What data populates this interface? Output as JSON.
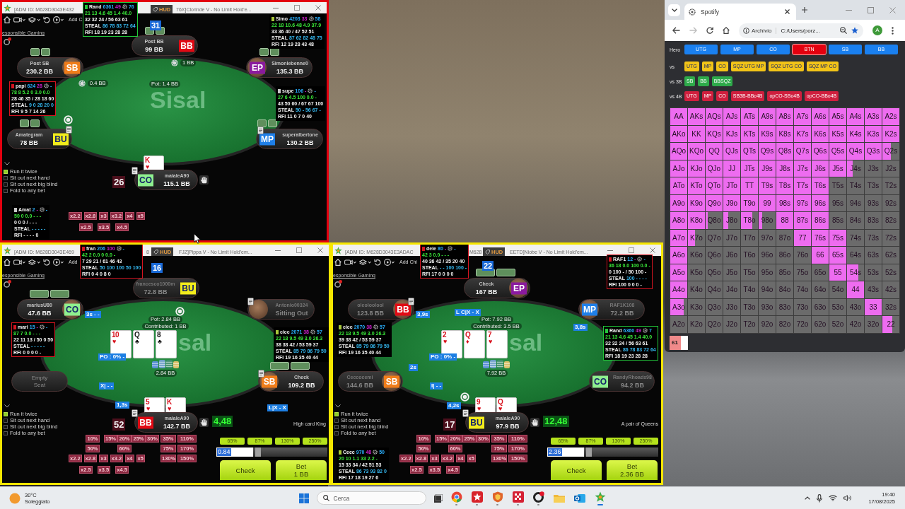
{
  "tables": [
    {
      "color": "#e3000f",
      "title": [
        "[ADM ID: M628D3043E432",
        "76X]Clorinde V - No Limit Hold'e..."
      ],
      "hud_tag": "HUD",
      "toolbar_link": "Add C",
      "responsible_gaming": "esponsible Gaming",
      "dealer_number": "31",
      "logo": "Sisal",
      "seats": [
        {
          "kind": "player",
          "label": "Post BB",
          "stack": "99 BB",
          "badge": {
            "text": "BB",
            "color": "#e10a14"
          },
          "active": true,
          "avatar": false,
          "has_cards": true
        },
        {
          "kind": "player",
          "label": "Post SB",
          "stack": "230.2 BB",
          "badge": {
            "text": "SB",
            "color": "#f07d1a"
          },
          "active": true,
          "avatar": true,
          "has_cards": true
        },
        {
          "kind": "player",
          "label": "Simonlebenne0",
          "stack": "135.3 BB",
          "badge": {
            "text": "EP",
            "color": "#8a1a9e"
          },
          "active": true,
          "avatar": true,
          "has_cards": true
        },
        {
          "kind": "player",
          "label": "Amategram",
          "stack": "78 BB",
          "badge": {
            "text": "BU",
            "color": "#f2ec1c"
          },
          "active": true,
          "avatar": false,
          "has_cards": true
        },
        {
          "kind": "player",
          "label": "superalbertone",
          "stack": "130.2 BB",
          "badge": {
            "text": "MP",
            "color": "#1f7fe8"
          },
          "active": true,
          "avatar": false,
          "has_cards": true
        },
        {
          "kind": "player",
          "label": "maialeA90",
          "stack": "115.1 BB",
          "badge": {
            "text": "CO",
            "color": "#8ff08f"
          },
          "active": true,
          "avatar": false,
          "has_cards": false
        }
      ],
      "huds": [
        {
          "name": "Rand",
          "count": "6361",
          "stat_1": "49",
          "stat_2": "76",
          "line_1": "21 13 4.6 45 1.4 40.0",
          "line_2": "32 32 24 / 56 63 61",
          "steal_label": "STEAL",
          "steal": "86 78 83 72 64",
          "rfi_label": "RFI",
          "rfi": "18 19 23 28 28",
          "color": "#22c83a",
          "outlined": true
        },
        {
          "name": "Simo",
          "count": "4203",
          "stat_1": "33",
          "stat_2": "58",
          "line_1": "22 18 10.6 48 4.9 37.9",
          "line_2": "33 36 40 / 47 52 51",
          "steal_label": "STEAL",
          "steal": "87 62 82 48 75",
          "rfi_label": "RFI",
          "rfi": "12 19 28 43 48",
          "color": "#a8c83a",
          "outlined": false
        },
        {
          "name": "papi",
          "count": "624",
          "stat_1": "28",
          "stat_2": "-",
          "line_1": "78 8 5.2 0 3.0 0.0",
          "line_2": "28 46 35 / 28 18 60",
          "steal_label": "STEAL",
          "steal": "9 0 28 20 0",
          "rfi_label": "RFI",
          "rfi": "9 5 7 14 26",
          "color": "#d41420",
          "outlined": true
        },
        {
          "name": "supe",
          "count": "106",
          "stat_1": "-",
          "stat_2": "-",
          "line_1": "27 6 4.5 100 0.0 -",
          "line_2": "43 50 60 / 67 67 100",
          "steal_label": "STEAL",
          "steal": "50 - 56 67 -",
          "rfi_label": "RFI",
          "rfi": "11 0 7 0 40",
          "color": "#c8c8c8",
          "outlined": false
        },
        {
          "name": "Amat",
          "count": "2",
          "stat_1": "-",
          "stat_2": "-",
          "line_1": "50 0 0.0 - - -",
          "line_2": "0 0 0 / - - -",
          "steal_label": "STEAL",
          "steal": "- - - - -",
          "rfi_label": "RFI",
          "rfi": "- - - - 0",
          "color": "#c8c8c8",
          "outlined": false
        }
      ],
      "pot": "Pot: 1.4 BB",
      "bets": [
        "0.4 BB",
        "1 BB"
      ],
      "hero_cards": [
        {
          "rank": "K",
          "suit": "♥",
          "color": "#d8101c"
        }
      ],
      "counter": "26",
      "options": [
        {
          "label": "Run it twice",
          "checked": true
        },
        {
          "label": "Sit out next hand",
          "checked": false
        },
        {
          "label": "Sit out next big blind",
          "checked": false
        },
        {
          "label": "Fold to any bet",
          "checked": false
        }
      ],
      "multipliers": [
        [
          "x2.2",
          "x2.8",
          "x3",
          "x3.2",
          "x4",
          "x5"
        ],
        [
          "x2.5",
          "x3.5",
          "x4.5"
        ]
      ]
    },
    {
      "color": "#f5e600",
      "title": [
        "[ADM ID: M628D3043E469",
        "8",
        "FJZ]Pippa V - No Limit Hold'em..."
      ],
      "hud_tag": "HUD",
      "toolbar_link": "Add",
      "responsible_gaming": "esponsible Gaming",
      "dealer_number": "16",
      "logo": "sal",
      "seats": [
        {
          "kind": "player",
          "label": "francesco1000m",
          "stack": "72.8 BB",
          "badge": {
            "text": "BU",
            "color": "#f2ec1c"
          },
          "active": false,
          "avatar": false,
          "has_cards": false
        },
        {
          "kind": "player",
          "label": "mariusU80",
          "stack": "47.6 BB",
          "badge": {
            "text": "CO",
            "color": "#8ff08f"
          },
          "active": true,
          "avatar": true,
          "has_cards": true
        },
        {
          "kind": "player",
          "label": "Antonio00324",
          "stack": "Sitting Out",
          "active": false,
          "avatar": true,
          "has_cards": false
        },
        {
          "kind": "empty",
          "label": "Empty Seat"
        },
        {
          "kind": "player",
          "label": "Check",
          "stack": "109.2 BB",
          "badge": {
            "text": "SB",
            "color": "#f07d1a"
          },
          "active": true,
          "avatar": true,
          "has_cards": true
        },
        {
          "kind": "player",
          "label": "maialeA90",
          "stack": "142.7 BB",
          "badge": {
            "text": "BB",
            "color": "#e10a14"
          },
          "active": true,
          "avatar": false,
          "has_cards": false
        }
      ],
      "huds": [
        {
          "name": "fran",
          "count": "206",
          "stat_1": "100",
          "stat_2": "-",
          "line_1": "42 2 0.0 0 0.0 -",
          "line_2": "7 29 21 / 61 46 43",
          "steal_label": "STEAL",
          "steal": "50 100 100 50 100",
          "rfi_label": "RFI",
          "rfi": "0 4 0 8 0",
          "color": "#d41420",
          "outlined": true
        },
        {
          "name": "mari",
          "count": "15",
          "stat_1": "-",
          "stat_2": "-",
          "line_1": "87 7 0.0 - - -",
          "line_2": "22 11 13 / 50 0 50",
          "steal_label": "STEAL",
          "steal": "- - - - -",
          "rfi_label": "RFI",
          "rfi": "0 0 0 0 -",
          "color": "#d41420",
          "outlined": true
        },
        {
          "name": "cicc",
          "count": "2071",
          "stat_1": "38",
          "stat_2": "57",
          "line_1": "22 18 9.5 49 3.0 26.3",
          "line_2": "38 38 42 / 53 59 37",
          "steal_label": "STEAL",
          "steal": "85 79 86 79 50",
          "rfi_label": "RFI",
          "rfi": "19 16 35 40 44",
          "color": "#a8c83a",
          "outlined": false
        }
      ],
      "board": [
        {
          "rank": "10",
          "suit": "♥",
          "color": "#d8101c"
        },
        {
          "rank": "Q",
          "suit": "♣",
          "color": "#111111"
        },
        {
          "rank": "8",
          "suit": "♣",
          "color": "#111111"
        }
      ],
      "pot": "Pot: 2.84 BB",
      "contributed": "Contributed: 1 BB",
      "bets": [
        "2.84 BB"
      ],
      "tags": [
        "3s - -",
        "PO : 0% -",
        "X| - -",
        "1,3s",
        "L|X - X"
      ],
      "hero_cards": [
        {
          "rank": "5",
          "suit": "♥",
          "color": "#d8101c"
        },
        {
          "rank": "K",
          "suit": "♥",
          "color": "#d8101c"
        }
      ],
      "counter": "52",
      "equity": "4,48",
      "hand_rank": "High card King",
      "options": [
        {
          "label": "Run it twice",
          "checked": true
        },
        {
          "label": "Sit out next hand",
          "checked": false
        },
        {
          "label": "Sit out next big blind",
          "checked": false
        },
        {
          "label": "Fold to any bet",
          "checked": false
        }
      ],
      "percents": [
        [
          "10%",
          "15%",
          "20%",
          "25%",
          "30%",
          "35%",
          "110%"
        ],
        [
          "50%",
          "60%",
          "75%",
          "170%"
        ],
        [
          "130%",
          "150%"
        ]
      ],
      "multipliers": [
        [
          "x2.2",
          "x2.8",
          "x3",
          "x3.2",
          "x4",
          "x5"
        ],
        [
          "x2.5",
          "x3.5",
          "x4.5"
        ]
      ],
      "action": {
        "presets": [
          "65%",
          "87%",
          "130%",
          "250%"
        ],
        "amount": "0.84",
        "slider": {
          "level": 0.03
        },
        "buttons": [
          {
            "label": "Check"
          },
          {
            "label": "Bet",
            "amount": "1 BB"
          }
        ]
      }
    },
    {
      "color": "#f5e600",
      "title": [
        "[ADM ID: M628D3043E3ADAC",
        "M628",
        "EETD]Niobe V - No Limit Hold'em..."
      ],
      "hud_tag": "HUD",
      "toolbar_link": "Add Chi",
      "responsible_gaming": "esponsible Gaming",
      "dealer_number": "22",
      "logo": "sal",
      "seats": [
        {
          "kind": "player",
          "label": "Check",
          "stack": "167 BB",
          "badge": {
            "text": "EP",
            "color": "#8a1a9e"
          },
          "active": true,
          "avatar": true,
          "has_cards": true
        },
        {
          "kind": "player",
          "label": "oleoloolool",
          "stack": "123.8 BB",
          "badge": {
            "text": "BB",
            "color": "#e10a14"
          },
          "active": false,
          "avatar": true,
          "has_cards": false
        },
        {
          "kind": "player",
          "label": "RAF1K108",
          "stack": "72.2 BB",
          "badge": {
            "text": "MP",
            "color": "#1f7fe8"
          },
          "active": false,
          "avatar": true,
          "has_cards": false
        },
        {
          "kind": "player",
          "label": "Ceccocemi",
          "stack": "144.6 BB",
          "badge": {
            "text": "SB",
            "color": "#f07d1a"
          },
          "active": false,
          "avatar": true,
          "has_cards": false
        },
        {
          "kind": "player",
          "label": "RandyRhoads98",
          "stack": "94.2 BB",
          "badge": {
            "text": "CO",
            "color": "#8ff08f"
          },
          "active": false,
          "avatar": false,
          "has_cards": false
        },
        {
          "kind": "player",
          "label": "maialeA90",
          "stack": "97.9 BB",
          "badge": {
            "text": "BU",
            "color": "#f2ec1c"
          },
          "active": true,
          "avatar": false,
          "has_cards": false
        }
      ],
      "huds": [
        {
          "name": "dele",
          "count": "80",
          "stat_1": "-",
          "stat_2": "-",
          "line_1": "42 3 0.0 - - -",
          "line_2": "40 36 42 / 35 20 40",
          "steal_label": "STEAL",
          "steal": "- - 100 100 -",
          "rfi_label": "RFI",
          "rfi": "17 0 0 0 0",
          "color": "#d41420",
          "outlined": true
        },
        {
          "name": "RAF1",
          "count": "12",
          "stat_1": "-",
          "stat_2": "-",
          "line_1": "36 18 0.0 100 0.0 -",
          "line_2": "0 100 - / 50 100 -",
          "steal_label": "STEAL",
          "steal": "100 - - - -",
          "rfi_label": "RFI",
          "rfi": "100 0 0 0 -",
          "color": "#d41420",
          "outlined": true
        },
        {
          "name": "cicc",
          "count": "2070",
          "stat_1": "38",
          "stat_2": "57",
          "line_1": "22 18 9.5 49 3.0 26.3",
          "line_2": "39 38 42 / 53 59 37",
          "steal_label": "STEAL",
          "steal": "85 79 86 79 50",
          "rfi_label": "RFI",
          "rfi": "19 16 35 40 44",
          "color": "#a8c83a",
          "outlined": false
        },
        {
          "name": "Rand",
          "count": "6360",
          "stat_1": "49",
          "stat_2": "7",
          "line_1": "21 13 4.6 45 1.4 40.0",
          "line_2": "32 32 24 / 56 63 61",
          "steal_label": "STEAL",
          "steal": "86 78 83 72 64",
          "rfi_label": "RFI",
          "rfi": "18 19 23 28 28",
          "color": "#22c83a",
          "outlined": true
        },
        {
          "name": "Cecc",
          "count": "970",
          "stat_1": "48",
          "stat_2": "50",
          "line_1": "20 10 1.1 33 2.2 -",
          "line_2": "15 33 34 / 42 51 53",
          "steal_label": "STEAL",
          "steal": "86 73 93 82 0",
          "rfi_label": "RFI",
          "rfi": "17 18 19 27 6",
          "color": "#a8c83a",
          "outlined": false
        }
      ],
      "board": [
        {
          "rank": "2",
          "suit": "♥",
          "color": "#d8101c"
        },
        {
          "rank": "Q",
          "suit": "♦",
          "color": "#d8101c"
        },
        {
          "rank": "7",
          "suit": "♥",
          "color": "#d8101c"
        }
      ],
      "pot": "Pot: 7.92 BB",
      "contributed": "Contributed: 3.5 BB",
      "bets": [
        "7.92 BB"
      ],
      "tags": [
        "3,9s",
        "L C|X - X",
        "3,8s",
        "PO : 0% -",
        "2s",
        "I| - -",
        "4,2s"
      ],
      "hero_cards": [
        {
          "rank": "9",
          "suit": "♥",
          "color": "#d8101c"
        },
        {
          "rank": "Q",
          "suit": "♥",
          "color": "#d8101c"
        }
      ],
      "counter": "17",
      "equity": "12,48",
      "hand_rank": "A pair of Queens",
      "options": [
        {
          "label": "Run it twice",
          "checked": true
        },
        {
          "label": "Sit out next hand",
          "checked": false
        },
        {
          "label": "Sit out next big blind",
          "checked": false
        },
        {
          "label": "Fold to any bet",
          "checked": false
        }
      ],
      "percents": [
        [
          "10%",
          "15%",
          "20%",
          "25%",
          "30%",
          "35%",
          "110%"
        ],
        [
          "50%",
          "60%",
          "75%",
          "170%"
        ],
        [
          "130%",
          "150%"
        ]
      ],
      "multipliers": [
        [
          "x2.2",
          "x2.8",
          "x3",
          "x3.2",
          "x4",
          "x5"
        ],
        [
          "x2.5",
          "x3.5",
          "x4.5"
        ]
      ],
      "action": {
        "presets": [
          "65%",
          "87%",
          "130%",
          "250%"
        ],
        "amount": "2.36",
        "slider": {
          "level": 0.03
        },
        "buttons": [
          {
            "label": "Check"
          },
          {
            "label": "Bet",
            "amount": "2.36 BB"
          }
        ]
      }
    }
  ],
  "browser": {
    "tab": "Spotify",
    "forward_disabled": true,
    "address_label": "Archivio",
    "address": "C:/Users/porz...",
    "profile": "A",
    "range_groups": [
      {
        "label": "Hero",
        "color": "#1a80f0",
        "buttons": [
          {
            "label": "UTG",
            "selected": false
          },
          {
            "label": "MP",
            "selected": false
          },
          {
            "label": "CO",
            "selected": false
          },
          {
            "label": "BTN",
            "selected": true
          },
          {
            "label": "SB",
            "selected": false
          },
          {
            "label": "BB",
            "selected": false
          }
        ]
      },
      {
        "label": "vs",
        "color": "#f2c418",
        "buttons": [
          {
            "label": "UTG",
            "selected": false
          },
          {
            "label": "MP",
            "selected": false
          },
          {
            "label": "CO",
            "selected": false
          },
          {
            "label": "SQZ UTG MP",
            "selected": false
          },
          {
            "label": "SQZ UTG CO",
            "selected": false
          },
          {
            "label": "SQZ MP CO",
            "selected": false
          }
        ]
      },
      {
        "label": "vs 3B",
        "color": "#2eaa4a",
        "buttons": [
          {
            "label": "SB",
            "selected": false
          },
          {
            "label": "BB",
            "selected": false
          },
          {
            "label": "BBSQZ",
            "selected": false
          }
        ]
      },
      {
        "label": "vs 4B",
        "color": "#cf1f3e",
        "buttons": [
          {
            "label": "UTG",
            "selected": false
          },
          {
            "label": "MP",
            "selected": false
          },
          {
            "label": "CO",
            "selected": false
          },
          {
            "label": "SB3B-BBc4B",
            "selected": false
          },
          {
            "label": "opCO-SBo4B",
            "selected": false
          },
          {
            "label": "opCO-BBo4B",
            "selected": false
          }
        ]
      }
    ],
    "range": [
      [
        {
          "hand": "AA",
          "in_range": true
        },
        {
          "hand": "AKs",
          "in_range": true
        },
        {
          "hand": "AQs",
          "in_range": true
        },
        {
          "hand": "AJs",
          "in_range": true
        },
        {
          "hand": "ATs",
          "in_range": true
        },
        {
          "hand": "A9s",
          "in_range": true
        },
        {
          "hand": "A8s",
          "in_range": true
        },
        {
          "hand": "A7s",
          "in_range": true
        },
        {
          "hand": "A6s",
          "in_range": true
        },
        {
          "hand": "A5s",
          "in_range": true
        },
        {
          "hand": "A4s",
          "in_range": true
        },
        {
          "hand": "A3s",
          "in_range": true
        },
        {
          "hand": "A2s",
          "in_range": true
        }
      ],
      [
        {
          "hand": "AKo",
          "in_range": true
        },
        {
          "hand": "KK",
          "in_range": true
        },
        {
          "hand": "KQs",
          "in_range": true
        },
        {
          "hand": "KJs",
          "in_range": true
        },
        {
          "hand": "KTs",
          "in_range": true
        },
        {
          "hand": "K9s",
          "in_range": true
        },
        {
          "hand": "K8s",
          "in_range": true
        },
        {
          "hand": "K7s",
          "in_range": true
        },
        {
          "hand": "K6s",
          "in_range": true
        },
        {
          "hand": "K5s",
          "in_range": true
        },
        {
          "hand": "K4s",
          "in_range": true
        },
        {
          "hand": "K3s",
          "in_range": true
        },
        {
          "hand": "K2s",
          "in_range": true
        }
      ],
      [
        {
          "hand": "AQo",
          "in_range": true
        },
        {
          "hand": "KQo",
          "in_range": true
        },
        {
          "hand": "QQ",
          "in_range": true
        },
        {
          "hand": "QJs",
          "in_range": true
        },
        {
          "hand": "QTs",
          "in_range": true
        },
        {
          "hand": "Q9s",
          "in_range": true
        },
        {
          "hand": "Q8s",
          "in_range": true
        },
        {
          "hand": "Q7s",
          "in_range": true
        },
        {
          "hand": "Q6s",
          "in_range": true
        },
        {
          "hand": "Q5s",
          "in_range": true
        },
        {
          "hand": "Q4s",
          "in_range": true
        },
        {
          "hand": "Q3s",
          "in_range": true
        },
        {
          "hand": "Q2s",
          "level": 0.5
        }
      ],
      [
        {
          "hand": "AJo",
          "in_range": true
        },
        {
          "hand": "KJo",
          "in_range": true
        },
        {
          "hand": "QJo",
          "in_range": true
        },
        {
          "hand": "JJ",
          "in_range": true
        },
        {
          "hand": "JTs",
          "in_range": true
        },
        {
          "hand": "J9s",
          "in_range": true
        },
        {
          "hand": "J8s",
          "in_range": true
        },
        {
          "hand": "J7s",
          "in_range": true
        },
        {
          "hand": "J6s",
          "in_range": true
        },
        {
          "hand": "J5s",
          "in_range": true
        },
        {
          "hand": "J4s",
          "level": 0.35
        },
        {
          "hand": "J3s",
          "in_range": false
        },
        {
          "hand": "J2s",
          "in_range": false
        }
      ],
      [
        {
          "hand": "ATo",
          "in_range": true
        },
        {
          "hand": "KTo",
          "in_range": true
        },
        {
          "hand": "QTo",
          "in_range": true
        },
        {
          "hand": "JTo",
          "in_range": true
        },
        {
          "hand": "TT",
          "in_range": true
        },
        {
          "hand": "T9s",
          "in_range": true
        },
        {
          "hand": "T8s",
          "in_range": true
        },
        {
          "hand": "T7s",
          "in_range": true
        },
        {
          "hand": "T6s",
          "in_range": true
        },
        {
          "hand": "T5s",
          "in_range": false
        },
        {
          "hand": "T4s",
          "in_range": false
        },
        {
          "hand": "T3s",
          "in_range": false
        },
        {
          "hand": "T2s",
          "in_range": false
        }
      ],
      [
        {
          "hand": "A9o",
          "in_range": true
        },
        {
          "hand": "K9o",
          "in_range": true
        },
        {
          "hand": "Q9o",
          "in_range": true
        },
        {
          "hand": "J9o",
          "in_range": true
        },
        {
          "hand": "T9o",
          "in_range": true
        },
        {
          "hand": "99",
          "in_range": true
        },
        {
          "hand": "98s",
          "in_range": true
        },
        {
          "hand": "97s",
          "in_range": true
        },
        {
          "hand": "96s",
          "in_range": true
        },
        {
          "hand": "95s",
          "in_range": false
        },
        {
          "hand": "94s",
          "in_range": false
        },
        {
          "hand": "93s",
          "in_range": false
        },
        {
          "hand": "92s",
          "in_range": false
        }
      ],
      [
        {
          "hand": "A8o",
          "in_range": true
        },
        {
          "hand": "K8o",
          "in_range": true
        },
        {
          "hand": "Q8o",
          "level": 0.13
        },
        {
          "hand": "J8o",
          "level": 0.3
        },
        {
          "hand": "T8o",
          "level": 0.65
        },
        {
          "hand": "98o",
          "level": 0.2
        },
        {
          "hand": "88",
          "in_range": true
        },
        {
          "hand": "87s",
          "in_range": true
        },
        {
          "hand": "86s",
          "in_range": true
        },
        {
          "hand": "85s",
          "in_range": false
        },
        {
          "hand": "84s",
          "in_range": false
        },
        {
          "hand": "83s",
          "in_range": false
        },
        {
          "hand": "82s",
          "in_range": false
        }
      ],
      [
        {
          "hand": "A7o",
          "in_range": true
        },
        {
          "hand": "K7o",
          "level": 0.4
        },
        {
          "hand": "Q7o",
          "in_range": false
        },
        {
          "hand": "J7o",
          "in_range": false
        },
        {
          "hand": "T7o",
          "in_range": false
        },
        {
          "hand": "97o",
          "in_range": false
        },
        {
          "hand": "87o",
          "in_range": false
        },
        {
          "hand": "77",
          "in_range": true
        },
        {
          "hand": "76s",
          "in_range": true
        },
        {
          "hand": "75s",
          "in_range": true
        },
        {
          "hand": "74s",
          "in_range": false
        },
        {
          "hand": "73s",
          "in_range": false
        },
        {
          "hand": "72s",
          "in_range": false
        }
      ],
      [
        {
          "hand": "A6o",
          "in_range": true
        },
        {
          "hand": "K6o",
          "in_range": false
        },
        {
          "hand": "Q6o",
          "in_range": false
        },
        {
          "hand": "J6o",
          "in_range": false
        },
        {
          "hand": "T6o",
          "in_range": false
        },
        {
          "hand": "96o",
          "in_range": false
        },
        {
          "hand": "86o",
          "in_range": false
        },
        {
          "hand": "76o",
          "in_range": false
        },
        {
          "hand": "66",
          "in_range": true
        },
        {
          "hand": "65s",
          "in_range": true
        },
        {
          "hand": "64s",
          "in_range": false
        },
        {
          "hand": "63s",
          "in_range": false
        },
        {
          "hand": "62s",
          "in_range": false
        }
      ],
      [
        {
          "hand": "A5o",
          "in_range": true
        },
        {
          "hand": "K5o",
          "in_range": false
        },
        {
          "hand": "Q5o",
          "in_range": false
        },
        {
          "hand": "J5o",
          "in_range": false
        },
        {
          "hand": "T5o",
          "in_range": false
        },
        {
          "hand": "95o",
          "in_range": false
        },
        {
          "hand": "85o",
          "in_range": false
        },
        {
          "hand": "75o",
          "in_range": false
        },
        {
          "hand": "65o",
          "in_range": false
        },
        {
          "hand": "55",
          "in_range": true
        },
        {
          "hand": "54s",
          "level": 0.68
        },
        {
          "hand": "53s",
          "in_range": false
        },
        {
          "hand": "52s",
          "in_range": false
        }
      ],
      [
        {
          "hand": "A4o",
          "in_range": true
        },
        {
          "hand": "K4o",
          "in_range": false
        },
        {
          "hand": "Q4o",
          "in_range": false
        },
        {
          "hand": "J4o",
          "in_range": false
        },
        {
          "hand": "T4o",
          "in_range": false
        },
        {
          "hand": "94o",
          "in_range": false
        },
        {
          "hand": "84o",
          "in_range": false
        },
        {
          "hand": "74o",
          "in_range": false
        },
        {
          "hand": "64o",
          "in_range": false
        },
        {
          "hand": "54o",
          "in_range": false
        },
        {
          "hand": "44",
          "in_range": true
        },
        {
          "hand": "43s",
          "in_range": false
        },
        {
          "hand": "42s",
          "in_range": false
        }
      ],
      [
        {
          "hand": "A3o",
          "level": 0.8
        },
        {
          "hand": "K3o",
          "in_range": false
        },
        {
          "hand": "Q3o",
          "in_range": false
        },
        {
          "hand": "J3o",
          "in_range": false
        },
        {
          "hand": "T3o",
          "in_range": false
        },
        {
          "hand": "93o",
          "in_range": false
        },
        {
          "hand": "83o",
          "in_range": false
        },
        {
          "hand": "73o",
          "in_range": false
        },
        {
          "hand": "63o",
          "in_range": false
        },
        {
          "hand": "53o",
          "in_range": false
        },
        {
          "hand": "43o",
          "in_range": false
        },
        {
          "hand": "33",
          "in_range": true
        },
        {
          "hand": "32s",
          "in_range": false
        }
      ],
      [
        {
          "hand": "A2o",
          "in_range": false
        },
        {
          "hand": "K2o",
          "in_range": false
        },
        {
          "hand": "Q2o",
          "in_range": false
        },
        {
          "hand": "J2o",
          "in_range": false
        },
        {
          "hand": "T2o",
          "in_range": false
        },
        {
          "hand": "92o",
          "in_range": false
        },
        {
          "hand": "82o",
          "in_range": false
        },
        {
          "hand": "72o",
          "in_range": false
        },
        {
          "hand": "62o",
          "in_range": false
        },
        {
          "hand": "52o",
          "in_range": false
        },
        {
          "hand": "42o",
          "in_range": false
        },
        {
          "hand": "32o",
          "in_range": false
        },
        {
          "hand": "22",
          "level": 0.6
        }
      ]
    ],
    "combos": {
      "text": "61",
      "level": 0.62
    }
  },
  "taskbar": {
    "weather": {
      "temperature": "30°C",
      "condition": "Soleggiato"
    },
    "search": {
      "placeholder": "Cerca"
    },
    "apps": [
      {
        "kind": "browser",
        "running": true,
        "selected": false
      },
      {
        "kind": "star-tile",
        "running": true,
        "selected": false
      },
      {
        "kind": "shield",
        "running": true,
        "selected": false
      },
      {
        "kind": "checker",
        "running": true,
        "selected": false
      },
      {
        "kind": "ring",
        "running": true,
        "selected": false
      },
      {
        "kind": "folder",
        "running": false,
        "selected": false
      },
      {
        "kind": "mail",
        "running": false,
        "selected": false
      },
      {
        "kind": "star",
        "running": true,
        "selected": true
      }
    ],
    "time": "19:40",
    "date": "17/08/2025"
  }
}
